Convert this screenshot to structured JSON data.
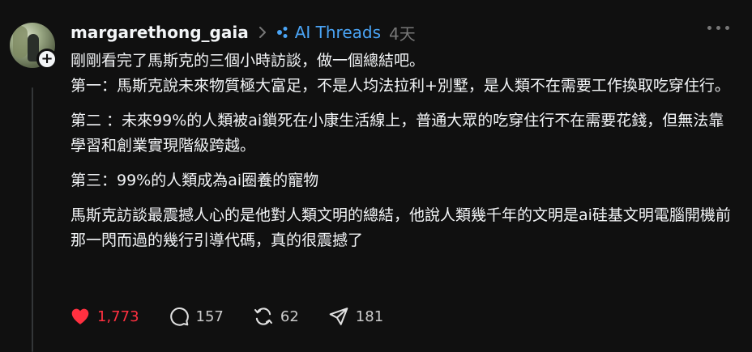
{
  "post": {
    "username": "margarethong_gaia",
    "topic": "AI Threads",
    "time": "4天",
    "paragraphs": [
      "剛剛看完了馬斯克的三個小時訪談，做一個總結吧。\n第一：馬斯克說未來物質極大富足，不是人均法拉利+別墅，是人類不在需要工作換取吃穿住行。",
      "第二 ：未來99%的人類被ai鎖死在小康生活線上，普通大眾的吃穿住行不在需要花錢，但無法靠學習和創業實現階級跨越。",
      "第三：99%的人類成為ai圈養的寵物",
      "馬斯克訪談最震撼人心的是他對人類文明的總結，他說人類幾千年的文明是ai硅基文明電腦開機前那一閃而過的幾行引導代碼，真的很震撼了"
    ],
    "add_badge": "+",
    "actions": {
      "likes": "1,773",
      "comments": "157",
      "reposts": "62",
      "shares": "181"
    },
    "icons": {
      "like": "heart-icon",
      "comment": "comment-bubble-icon",
      "repost": "repost-icon",
      "share": "send-icon",
      "more": "more-dots-icon",
      "topic": "topic-icon"
    },
    "colors": {
      "background": "#101010",
      "text": "#f3f5f7",
      "topic": "#4aa4f5",
      "muted": "#777777",
      "liked": "#ff3040"
    }
  }
}
